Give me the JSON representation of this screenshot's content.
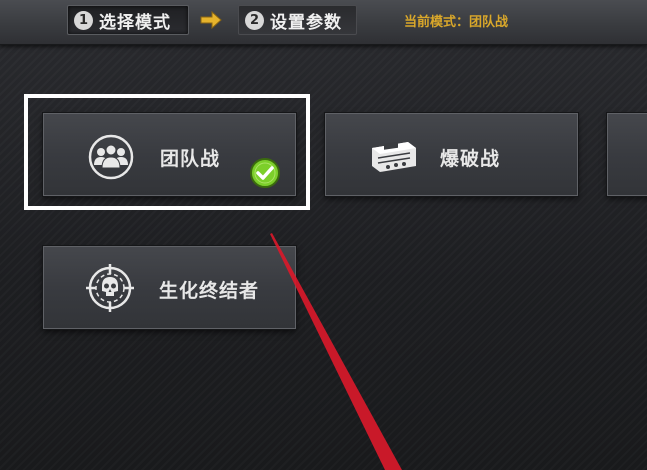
{
  "steps": [
    {
      "number": "1",
      "label": "选择模式"
    },
    {
      "number": "2",
      "label": "设置参数"
    }
  ],
  "current_mode": {
    "prefix": "当前模式：",
    "value": "团队战"
  },
  "modes": {
    "team": {
      "label": "团队战",
      "icon": "team-icon",
      "selected": true
    },
    "demolition": {
      "label": "爆破战",
      "icon": "bomb-icon",
      "selected": false
    },
    "zombie": {
      "label": "生化终结者",
      "icon": "skull-target-icon",
      "selected": false
    }
  },
  "colors": {
    "accent_text": "#d9a72a",
    "check_green": "#7ccf2a",
    "annotation_red": "#d8192a",
    "highlight_border": "#ffffff"
  }
}
